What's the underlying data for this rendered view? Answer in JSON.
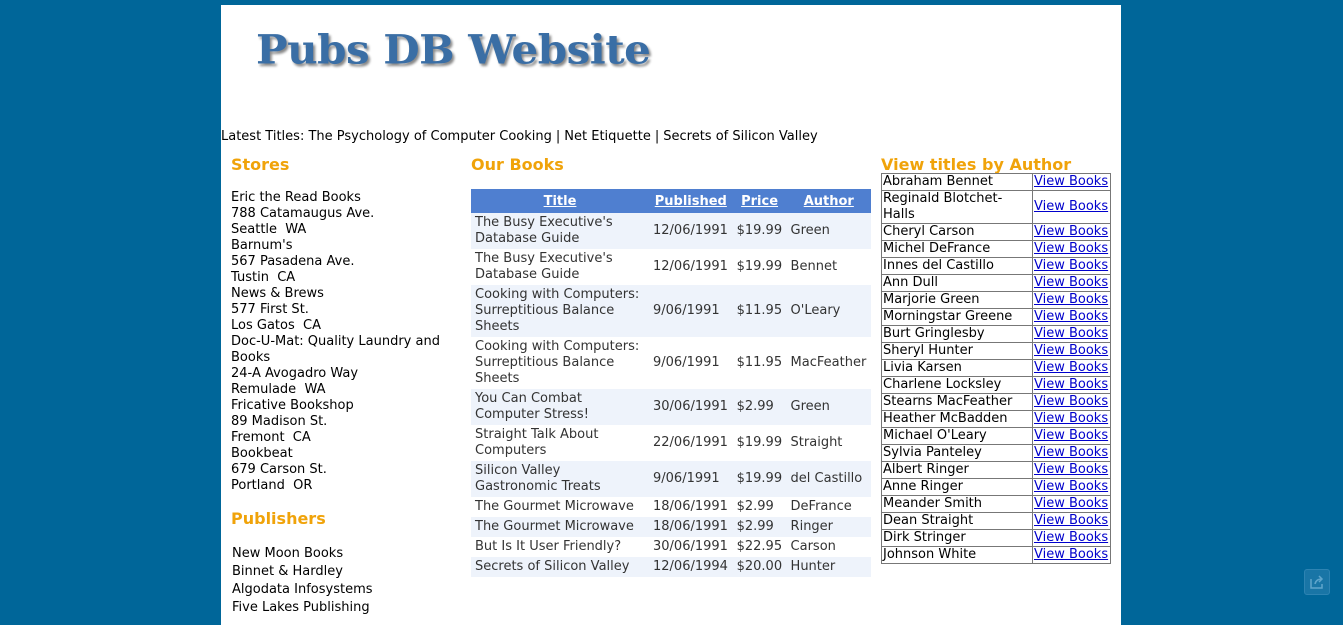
{
  "site": {
    "logo": "Pubs DB Website"
  },
  "latest": {
    "label": "Latest Titles:",
    "titles": [
      "The Psychology of Computer Cooking",
      "Net Etiquette",
      "Secrets of Silicon Valley"
    ]
  },
  "stores": {
    "heading": "Stores",
    "items": [
      {
        "name": "Eric the Read Books",
        "street": "788 Catamaugus Ave.",
        "city": "Seattle  WA"
      },
      {
        "name": "Barnum's",
        "street": "567 Pasadena Ave.",
        "city": "Tustin  CA"
      },
      {
        "name": "News & Brews",
        "street": "577 First St.",
        "city": "Los Gatos  CA"
      },
      {
        "name": "Doc-U-Mat: Quality Laundry and Books",
        "street": "24-A Avogadro Way",
        "city": "Remulade  WA"
      },
      {
        "name": "Fricative Bookshop",
        "street": "89 Madison St.",
        "city": "Fremont  CA"
      },
      {
        "name": "Bookbeat",
        "street": "679 Carson St.",
        "city": "Portland  OR"
      }
    ]
  },
  "publishers": {
    "heading": "Publishers",
    "items": [
      "New Moon Books",
      "Binnet & Hardley",
      "Algodata Infosystems",
      "Five Lakes Publishing"
    ]
  },
  "books": {
    "heading": "Our Books",
    "columns": [
      "Title",
      "Published",
      "Price",
      "Author"
    ],
    "rows": [
      [
        "The Busy Executive's Database Guide",
        "12/06/1991",
        "$19.99",
        "Green"
      ],
      [
        "The Busy Executive's Database Guide",
        "12/06/1991",
        "$19.99",
        "Bennet"
      ],
      [
        "Cooking with Computers: Surreptitious Balance Sheets",
        "9/06/1991",
        "$11.95",
        "O'Leary"
      ],
      [
        "Cooking with Computers: Surreptitious Balance Sheets",
        "9/06/1991",
        "$11.95",
        "MacFeather"
      ],
      [
        "You Can Combat Computer Stress!",
        "30/06/1991",
        "$2.99",
        "Green"
      ],
      [
        "Straight Talk About Computers",
        "22/06/1991",
        "$19.99",
        "Straight"
      ],
      [
        "Silicon Valley Gastronomic Treats",
        "9/06/1991",
        "$19.99",
        "del Castillo"
      ],
      [
        "The Gourmet Microwave",
        "18/06/1991",
        "$2.99",
        "DeFrance"
      ],
      [
        "The Gourmet Microwave",
        "18/06/1991",
        "$2.99",
        "Ringer"
      ],
      [
        "But Is It User Friendly?",
        "30/06/1991",
        "$22.95",
        "Carson"
      ],
      [
        "Secrets of Silicon Valley",
        "12/06/1994",
        "$20.00",
        "Hunter"
      ]
    ]
  },
  "authors": {
    "heading": "View titles by Author",
    "link_label": "View Books",
    "names": [
      "Abraham Bennet",
      "Reginald Blotchet-Halls",
      "Cheryl Carson",
      "Michel DeFrance",
      "Innes del Castillo",
      "Ann Dull",
      "Marjorie Green",
      "Morningstar Greene",
      "Burt Gringlesby",
      "Sheryl Hunter",
      "Livia Karsen",
      "Charlene Locksley",
      "Stearns MacFeather",
      "Heather McBadden",
      "Michael O'Leary",
      "Sylvia Panteley",
      "Albert Ringer",
      "Anne Ringer",
      "Meander Smith",
      "Dean Straight",
      "Dirk Stringer",
      "Johnson White"
    ]
  },
  "colors": {
    "background": "#006699",
    "heading": "#f0a30a",
    "table_header": "#4f7fd0",
    "logo": "#3a6ea5"
  },
  "icons": {
    "share": "share-icon"
  }
}
